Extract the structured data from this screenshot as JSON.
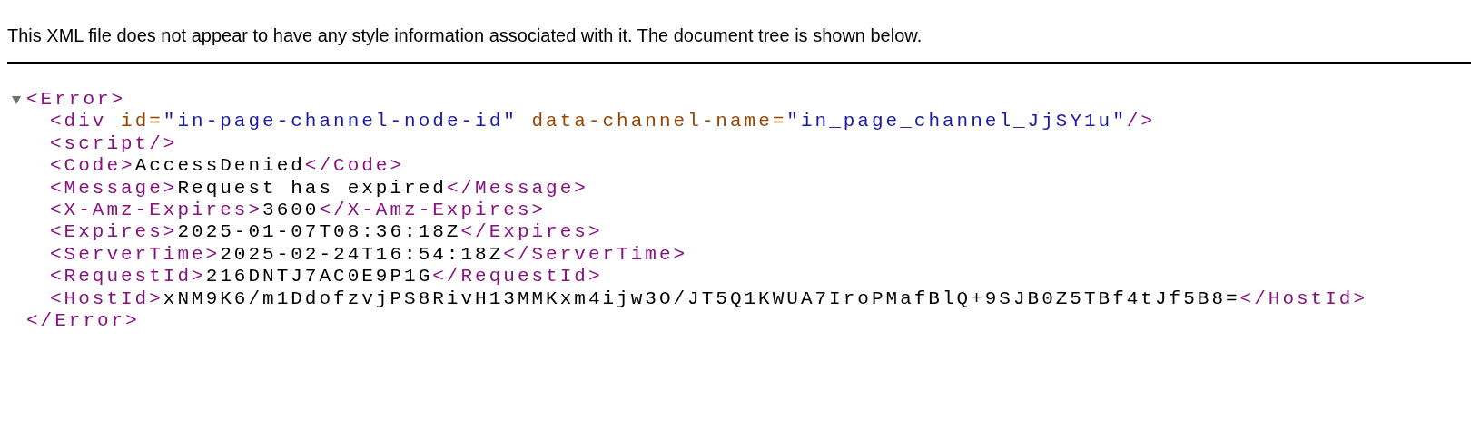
{
  "notice": "This XML file does not appear to have any style information associated with it. The document tree is shown below.",
  "tree": {
    "open": "<Error>",
    "close": "</Error>",
    "expanded": true,
    "children": [
      {
        "tokens": [
          {
            "kind": "tag",
            "text": "<div"
          },
          {
            "kind": "attr-name",
            "text": " id="
          },
          {
            "kind": "attr-value",
            "text": "\"in-page-channel-node-id\""
          },
          {
            "kind": "attr-name",
            "text": " data-channel-name="
          },
          {
            "kind": "attr-value",
            "text": "\"in_page_channel_JjSY1u\""
          },
          {
            "kind": "tag",
            "text": "/>"
          }
        ]
      },
      {
        "tokens": [
          {
            "kind": "tag",
            "text": "<script/>"
          }
        ]
      },
      {
        "tokens": [
          {
            "kind": "tag",
            "text": "<Code>"
          },
          {
            "kind": "text",
            "text": "AccessDenied"
          },
          {
            "kind": "tag",
            "text": "</Code>"
          }
        ]
      },
      {
        "tokens": [
          {
            "kind": "tag",
            "text": "<Message>"
          },
          {
            "kind": "text",
            "text": "Request has expired"
          },
          {
            "kind": "tag",
            "text": "</Message>"
          }
        ]
      },
      {
        "tokens": [
          {
            "kind": "tag",
            "text": "<X-Amz-Expires>"
          },
          {
            "kind": "text",
            "text": "3600"
          },
          {
            "kind": "tag",
            "text": "</X-Amz-Expires>"
          }
        ]
      },
      {
        "tokens": [
          {
            "kind": "tag",
            "text": "<Expires>"
          },
          {
            "kind": "text",
            "text": "2025-01-07T08:36:18Z"
          },
          {
            "kind": "tag",
            "text": "</Expires>"
          }
        ]
      },
      {
        "tokens": [
          {
            "kind": "tag",
            "text": "<ServerTime>"
          },
          {
            "kind": "text",
            "text": "2025-02-24T16:54:18Z"
          },
          {
            "kind": "tag",
            "text": "</ServerTime>"
          }
        ]
      },
      {
        "tokens": [
          {
            "kind": "tag",
            "text": "<RequestId>"
          },
          {
            "kind": "text",
            "text": "216DNTJ7AC0E9P1G"
          },
          {
            "kind": "tag",
            "text": "</RequestId>"
          }
        ]
      },
      {
        "tokens": [
          {
            "kind": "tag",
            "text": "<HostId>"
          },
          {
            "kind": "text",
            "text": "xNM9K6/m1DdofzvjPS8RivH13MMKxm4ijw3O/JT5Q1KWUA7IroPMafBlQ+9SJB0Z5TBf4tJf5B8="
          },
          {
            "kind": "tag",
            "text": "</HostId>"
          }
        ]
      }
    ]
  }
}
